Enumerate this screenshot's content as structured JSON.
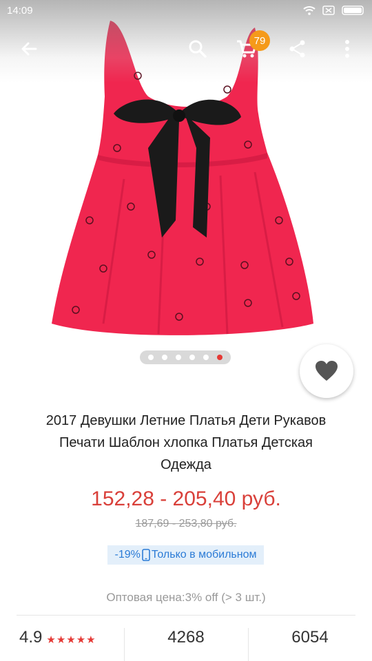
{
  "status_bar": {
    "time": "14:09"
  },
  "toolbar": {
    "cart_count": "79",
    "icons": [
      "back-arrow-icon",
      "search-icon",
      "cart-icon",
      "share-icon",
      "more-vertical-icon"
    ]
  },
  "gallery": {
    "total_images": 6,
    "active_index": 6
  },
  "product": {
    "title_lines": [
      "2017 Девушки Летние Платья Дети Рукавов",
      "Печати Шаблон хлопка Платья Детская",
      "Одежда"
    ],
    "price": "152,28 - 205,40 руб.",
    "old_price": "187,69 - 253,80 руб.",
    "mobile_discount": "-19%",
    "mobile_label": "Только в мобильном",
    "wholesale": "Оптовая цена:3% off (> 3 шт.)"
  },
  "stats": {
    "rating": "4.9",
    "rating_stars": "★★★★★",
    "reviews": "4268",
    "orders": "6054"
  },
  "colors": {
    "price_red": "#d9403a",
    "badge_orange": "#f59a1a",
    "mobile_blue": "#2b7bd6",
    "dress_red": "#f0264f"
  }
}
